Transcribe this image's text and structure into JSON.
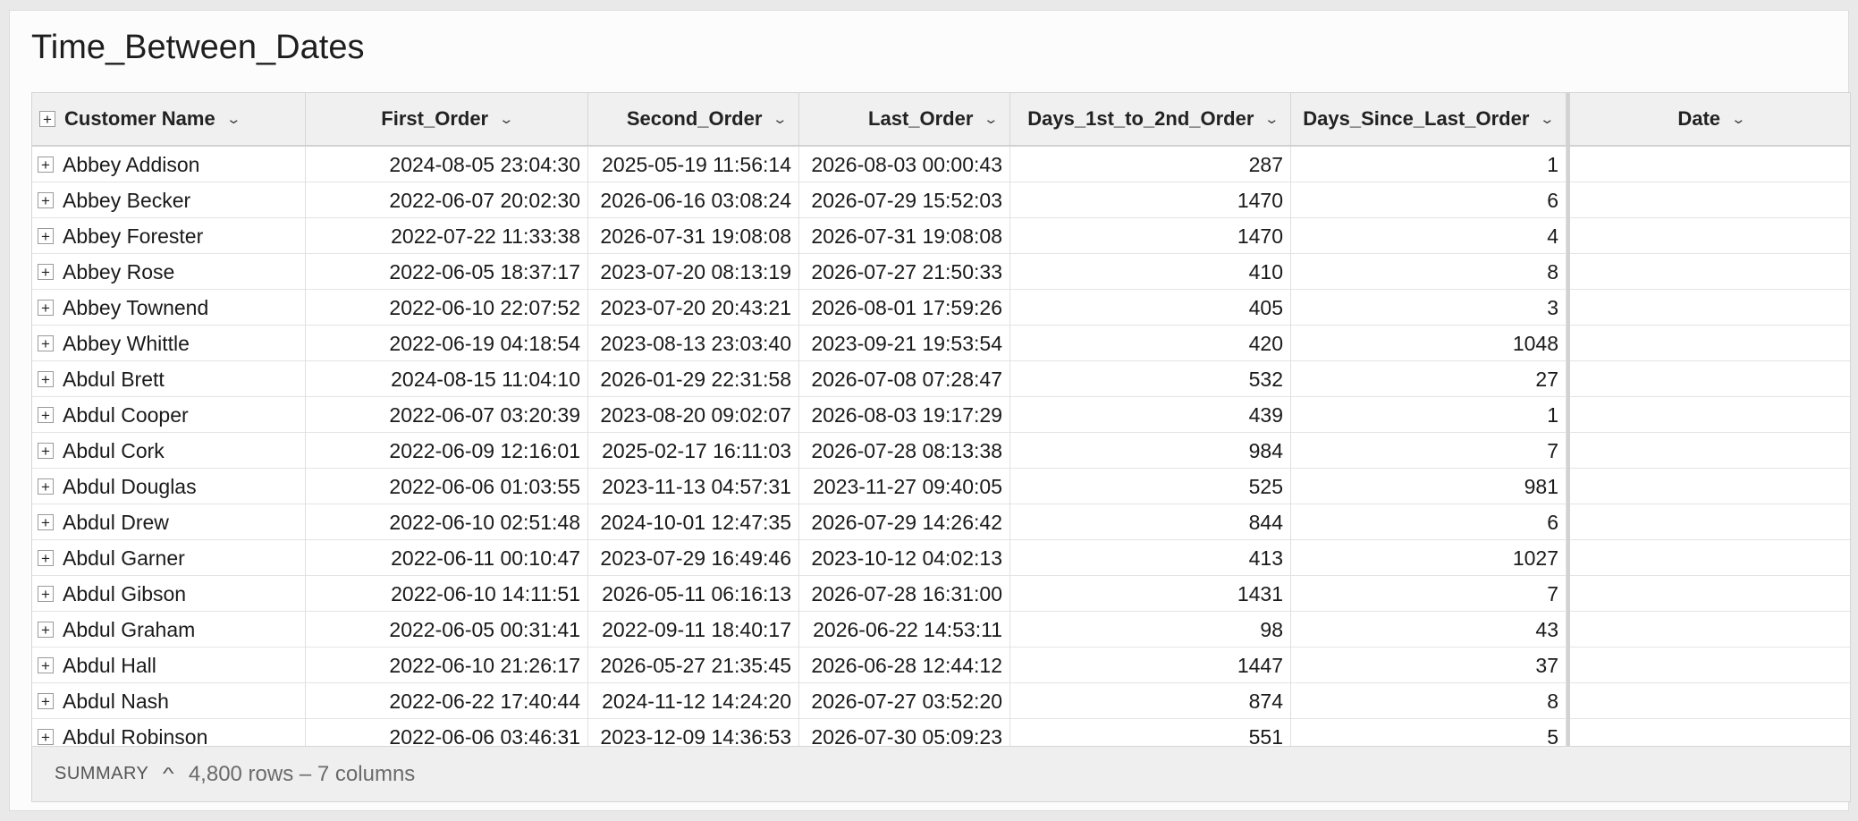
{
  "title": "Time_Between_Dates",
  "columns": [
    {
      "key": "name",
      "label": "Customer Name"
    },
    {
      "key": "first",
      "label": "First_Order"
    },
    {
      "key": "second",
      "label": "Second_Order"
    },
    {
      "key": "last",
      "label": "Last_Order"
    },
    {
      "key": "d12",
      "label": "Days_1st_to_2nd_Order"
    },
    {
      "key": "dsl",
      "label": "Days_Since_Last_Order"
    },
    {
      "key": "date",
      "label": "Date"
    }
  ],
  "rows": [
    {
      "name": "Abbey Addison",
      "first": "2024-08-05 23:04:30",
      "second": "2025-05-19 11:56:14",
      "last": "2026-08-03 00:00:43",
      "d12": "287",
      "dsl": "1",
      "date": ""
    },
    {
      "name": "Abbey Becker",
      "first": "2022-06-07 20:02:30",
      "second": "2026-06-16 03:08:24",
      "last": "2026-07-29 15:52:03",
      "d12": "1470",
      "dsl": "6",
      "date": ""
    },
    {
      "name": "Abbey Forester",
      "first": "2022-07-22 11:33:38",
      "second": "2026-07-31 19:08:08",
      "last": "2026-07-31 19:08:08",
      "d12": "1470",
      "dsl": "4",
      "date": ""
    },
    {
      "name": "Abbey Rose",
      "first": "2022-06-05 18:37:17",
      "second": "2023-07-20 08:13:19",
      "last": "2026-07-27 21:50:33",
      "d12": "410",
      "dsl": "8",
      "date": ""
    },
    {
      "name": "Abbey Townend",
      "first": "2022-06-10 22:07:52",
      "second": "2023-07-20 20:43:21",
      "last": "2026-08-01 17:59:26",
      "d12": "405",
      "dsl": "3",
      "date": ""
    },
    {
      "name": "Abbey Whittle",
      "first": "2022-06-19 04:18:54",
      "second": "2023-08-13 23:03:40",
      "last": "2023-09-21 19:53:54",
      "d12": "420",
      "dsl": "1048",
      "date": ""
    },
    {
      "name": "Abdul Brett",
      "first": "2024-08-15 11:04:10",
      "second": "2026-01-29 22:31:58",
      "last": "2026-07-08 07:28:47",
      "d12": "532",
      "dsl": "27",
      "date": ""
    },
    {
      "name": "Abdul Cooper",
      "first": "2022-06-07 03:20:39",
      "second": "2023-08-20 09:02:07",
      "last": "2026-08-03 19:17:29",
      "d12": "439",
      "dsl": "1",
      "date": ""
    },
    {
      "name": "Abdul Cork",
      "first": "2022-06-09 12:16:01",
      "second": "2025-02-17 16:11:03",
      "last": "2026-07-28 08:13:38",
      "d12": "984",
      "dsl": "7",
      "date": ""
    },
    {
      "name": "Abdul Douglas",
      "first": "2022-06-06 01:03:55",
      "second": "2023-11-13 04:57:31",
      "last": "2023-11-27 09:40:05",
      "d12": "525",
      "dsl": "981",
      "date": ""
    },
    {
      "name": "Abdul Drew",
      "first": "2022-06-10 02:51:48",
      "second": "2024-10-01 12:47:35",
      "last": "2026-07-29 14:26:42",
      "d12": "844",
      "dsl": "6",
      "date": ""
    },
    {
      "name": "Abdul Garner",
      "first": "2022-06-11 00:10:47",
      "second": "2023-07-29 16:49:46",
      "last": "2023-10-12 04:02:13",
      "d12": "413",
      "dsl": "1027",
      "date": ""
    },
    {
      "name": "Abdul Gibson",
      "first": "2022-06-10 14:11:51",
      "second": "2026-05-11 06:16:13",
      "last": "2026-07-28 16:31:00",
      "d12": "1431",
      "dsl": "7",
      "date": ""
    },
    {
      "name": "Abdul Graham",
      "first": "2022-06-05 00:31:41",
      "second": "2022-09-11 18:40:17",
      "last": "2026-06-22 14:53:11",
      "d12": "98",
      "dsl": "43",
      "date": ""
    },
    {
      "name": "Abdul Hall",
      "first": "2022-06-10 21:26:17",
      "second": "2026-05-27 21:35:45",
      "last": "2026-06-28 12:44:12",
      "d12": "1447",
      "dsl": "37",
      "date": ""
    },
    {
      "name": "Abdul Nash",
      "first": "2022-06-22 17:40:44",
      "second": "2024-11-12 14:24:20",
      "last": "2026-07-27 03:52:20",
      "d12": "874",
      "dsl": "8",
      "date": ""
    },
    {
      "name": "Abdul Robinson",
      "first": "2022-06-06 03:46:31",
      "second": "2023-12-09 14:36:53",
      "last": "2026-07-30 05:09:23",
      "d12": "551",
      "dsl": "5",
      "date": ""
    }
  ],
  "summary": {
    "label": "SUMMARY",
    "info": "4,800 rows – 7 columns"
  }
}
